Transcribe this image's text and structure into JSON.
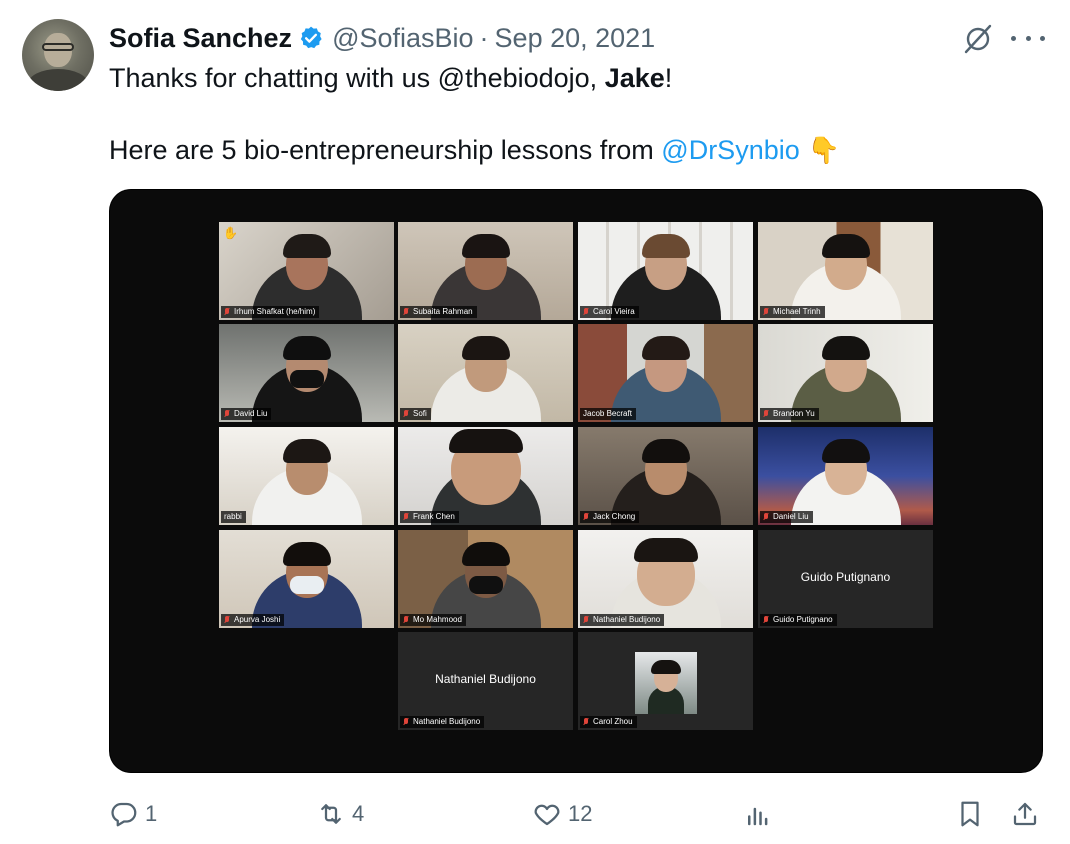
{
  "tweet": {
    "display_name": "Sofia Sanchez",
    "handle": "@SofiasBio",
    "separator": "·",
    "date": "Sep 20, 2021",
    "text_line1_prefix": "Thanks for chatting with us @thebiodojo, ",
    "text_line1_bold": "Jake",
    "text_line1_suffix": "!",
    "text_line2_prefix": "Here are 5 bio-entrepreneurship lessons from ",
    "text_line2_mention": "@DrSynbio",
    "text_line2_emoji": "👇"
  },
  "participants": [
    {
      "name": "Irhum Shafkat (he/him)",
      "hand_raised": true
    },
    {
      "name": "Subaita Rahman"
    },
    {
      "name": "Carol Vieira"
    },
    {
      "name": "Michael Trinh"
    },
    {
      "name": "David Liu"
    },
    {
      "name": "Sofi"
    },
    {
      "name": "Jacob Becraft"
    },
    {
      "name": "Brandon Yu"
    },
    {
      "name": "rabbi"
    },
    {
      "name": "Frank Chen"
    },
    {
      "name": "Jack Chong"
    },
    {
      "name": "Daniel Liu"
    },
    {
      "name": "Apurva Joshi"
    },
    {
      "name": "Mo Mahmood"
    },
    {
      "name": "Nathaniel Budijono"
    },
    {
      "name": "Guido Putignano",
      "center_name": "Guido Putignano"
    },
    {
      "name": "Nathaniel Budijono",
      "center_name": "Nathaniel Budijono"
    },
    {
      "name": "Carol Zhou"
    }
  ],
  "actions": {
    "replies": "1",
    "retweets": "4",
    "likes": "12"
  },
  "colors": {
    "accent": "#1d9bf0",
    "muted": "#536471",
    "text": "#0f1419"
  }
}
